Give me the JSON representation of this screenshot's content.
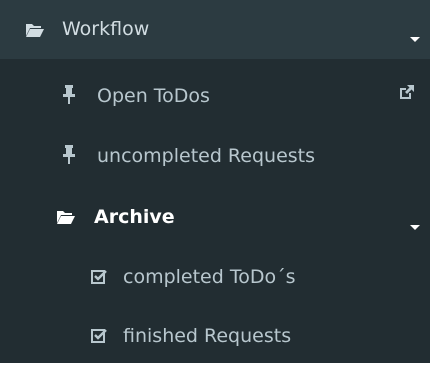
{
  "menu": {
    "workflow": {
      "label": "Workflow",
      "icon": "folder-open-icon",
      "expand_icon": "caret-down-icon"
    },
    "items": [
      {
        "label": "Open ToDos",
        "icon": "pin-icon",
        "extra_icon": "external-link-icon"
      },
      {
        "label": "uncompleted Requests",
        "icon": "pin-icon"
      }
    ],
    "archive": {
      "label": "Archive",
      "icon": "folder-open-icon",
      "expand_icon": "caret-down-icon",
      "items": [
        {
          "label": "completed ToDo´s",
          "icon": "checkbox-checked-icon"
        },
        {
          "label": "finished Requests",
          "icon": "checkbox-checked-icon"
        }
      ]
    }
  },
  "colors": {
    "sidebar_bg": "#222d32",
    "header_bg": "#2c3b41",
    "text": "#b8c7ce",
    "active_text": "#ffffff"
  }
}
